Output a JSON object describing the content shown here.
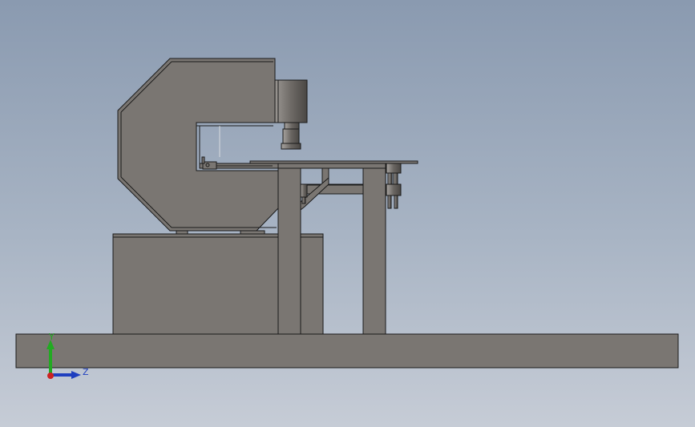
{
  "viewport": {
    "background_top": "#8a9ab0",
    "background_bottom": "#c6ccd6",
    "part_color": "#7a7672",
    "edge_color": "#1a1a1a"
  },
  "triad": {
    "y_label": "Y",
    "z_label": "Z",
    "y_color": "#22aa22",
    "z_color": "#1f3fbf",
    "x_color": "#cc2222"
  }
}
